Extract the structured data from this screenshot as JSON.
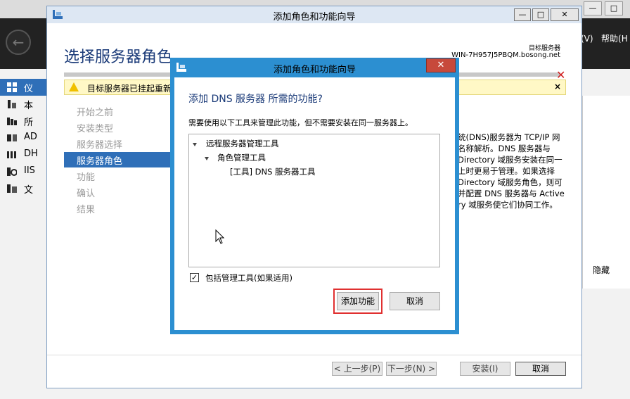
{
  "server_manager": {
    "menu_text": "(V)   帮助(H",
    "nav_items": [
      "仪",
      "本",
      "所",
      "AD",
      "DH",
      "IIS",
      "文"
    ],
    "hide_label": "隐藏"
  },
  "wizard": {
    "title": "添加角色和功能向导",
    "heading": "选择服务器角色",
    "target_label": "目标服务器",
    "target_name": "WIN-7H957J5PBQM.bosong.net",
    "warning_text": "目标服务器已挂起重新启动",
    "warning_close": "×",
    "steps": [
      "开始之前",
      "安装类型",
      "服务器选择",
      "服务器角色",
      "功能",
      "确认",
      "结果"
    ],
    "active_step": "服务器角色",
    "description_lines": [
      "统(DNS)服务器为 TCP/IP 网",
      "名称解析。DNS 服务器与",
      "Directory 域服务安装在同一",
      "上时更易于管理。如果选择",
      "Directory 域服务角色，则可",
      "并配置 DNS 服务器与 Active",
      "ry 域服务使它们协同工作。"
    ],
    "buttons": {
      "prev": "< 上一步(P)",
      "next": "下一步(N) >",
      "install": "安装(I)",
      "cancel": "取消"
    }
  },
  "dialog": {
    "title": "添加角色和功能向导",
    "close_label": "✕",
    "heading": "添加 DNS 服务器 所需的功能?",
    "instruction": "需要使用以下工具来管理此功能，但不需要安装在同一服务器上。",
    "tree": [
      {
        "label": "远程服务器管理工具",
        "level": 0,
        "expanded": true
      },
      {
        "label": "角色管理工具",
        "level": 1,
        "expanded": true
      },
      {
        "label": "[工具] DNS 服务器工具",
        "level": 2,
        "expanded": false
      }
    ],
    "include_tools_label": "包括管理工具(如果适用)",
    "include_tools_checked": true,
    "add_button": "添加功能",
    "cancel_button": "取消"
  },
  "colors": {
    "accent": "#2f6fb8",
    "dialog_frame": "#2c8fd1",
    "highlight": "#e03030"
  }
}
